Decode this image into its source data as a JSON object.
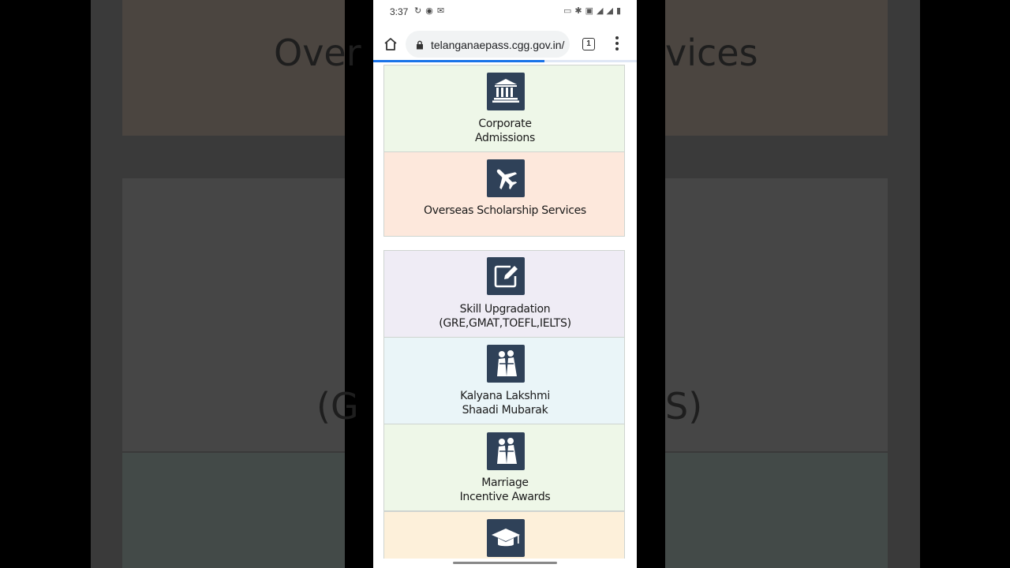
{
  "status_bar": {
    "time": "3:37"
  },
  "browser": {
    "url": "telanganaepass.cgg.gov.in/",
    "tab_count": "1",
    "load_progress": 0.65
  },
  "background": {
    "text_top_left": "Over",
    "text_top_right": "vices",
    "text_mid_left": "(G",
    "text_mid_right": "S)"
  },
  "cards": [
    {
      "icon": "bank-icon",
      "line1": "Corporate",
      "line2": "Admissions",
      "bg": "#eef7e8"
    },
    {
      "icon": "airplane-icon",
      "line1": "Overseas Scholarship Services",
      "line2": "",
      "bg": "#fde8dc"
    },
    {
      "icon": "edit-icon",
      "line1": "Skill Upgradation",
      "line2": "(GRE,GMAT,TOEFL,IELTS)",
      "bg": "#efecf5"
    },
    {
      "icon": "wedding-couple-icon",
      "line1": "Kalyana Lakshmi",
      "line2": "Shaadi Mubarak",
      "bg": "#eaf5f8"
    },
    {
      "icon": "wedding-couple-icon",
      "line1": "Marriage",
      "line2": "Incentive Awards",
      "bg": "#eef7e8"
    },
    {
      "icon": "graduation-cap-icon",
      "line1": "",
      "line2": "",
      "bg": "#fdf0da"
    }
  ],
  "colors": {
    "icon_tile": "#2f4158",
    "progress": "#1a73e8"
  }
}
